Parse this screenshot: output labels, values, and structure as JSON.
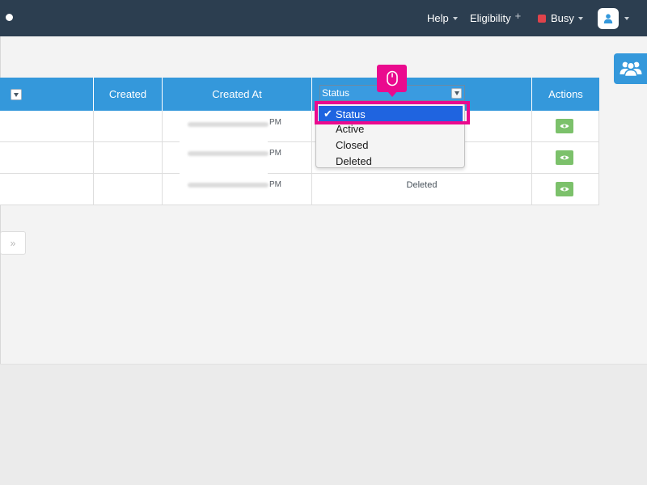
{
  "navbar": {
    "help_label": "Help",
    "eligibility_label": "Eligibility",
    "eligibility_plus": "+",
    "status_label": "Busy",
    "status_color": "#e0434b",
    "background": "#2c3e50"
  },
  "table": {
    "header_color": "#3498db",
    "columns": {
      "created": "Created",
      "created_at": "Created At",
      "status": "Status",
      "actions": "Actions"
    },
    "rows": [
      {
        "created_at_suffix": "PM",
        "status": ""
      },
      {
        "created_at_suffix": "PM",
        "status": ""
      },
      {
        "created_at_suffix": "PM",
        "status": "Deleted"
      }
    ]
  },
  "status_filter": {
    "selected": "Status",
    "options": [
      "Status",
      "Active",
      "Closed",
      "Deleted"
    ],
    "check_mark": "✔"
  },
  "pagination": {
    "next_label": "»"
  },
  "annotation": {
    "color": "#ea0a8e",
    "icon": "mouse-icon"
  },
  "icons": {
    "team": "users-icon",
    "view": "eye-icon",
    "avatar": "user-icon"
  }
}
